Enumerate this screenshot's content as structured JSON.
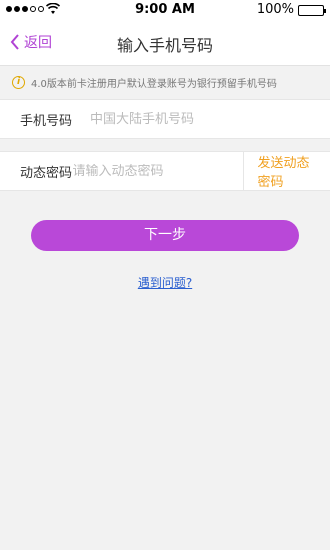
{
  "status_bar": {
    "time": "9:00 AM",
    "battery_text": "100%",
    "signal_icon": "signal-dots-icon",
    "wifi_icon": "wifi-icon",
    "battery_icon": "battery-icon"
  },
  "nav": {
    "back_label": "返回",
    "title": "输入手机号码",
    "accent_color": "#b042d4"
  },
  "notice": {
    "icon": "info-icon",
    "text": "4.0版本前卡注册用户默认登录账号为银行预留手机号码"
  },
  "form": {
    "phone": {
      "label": "手机号码",
      "placeholder": "中国大陆手机号码",
      "value": ""
    },
    "code": {
      "label": "动态密码",
      "placeholder": "请输入动态密码",
      "value": "",
      "send_label": "发送动态密码"
    }
  },
  "actions": {
    "next_label": "下一步",
    "help_label": "遇到问题?",
    "button_color": "#b948d8"
  }
}
